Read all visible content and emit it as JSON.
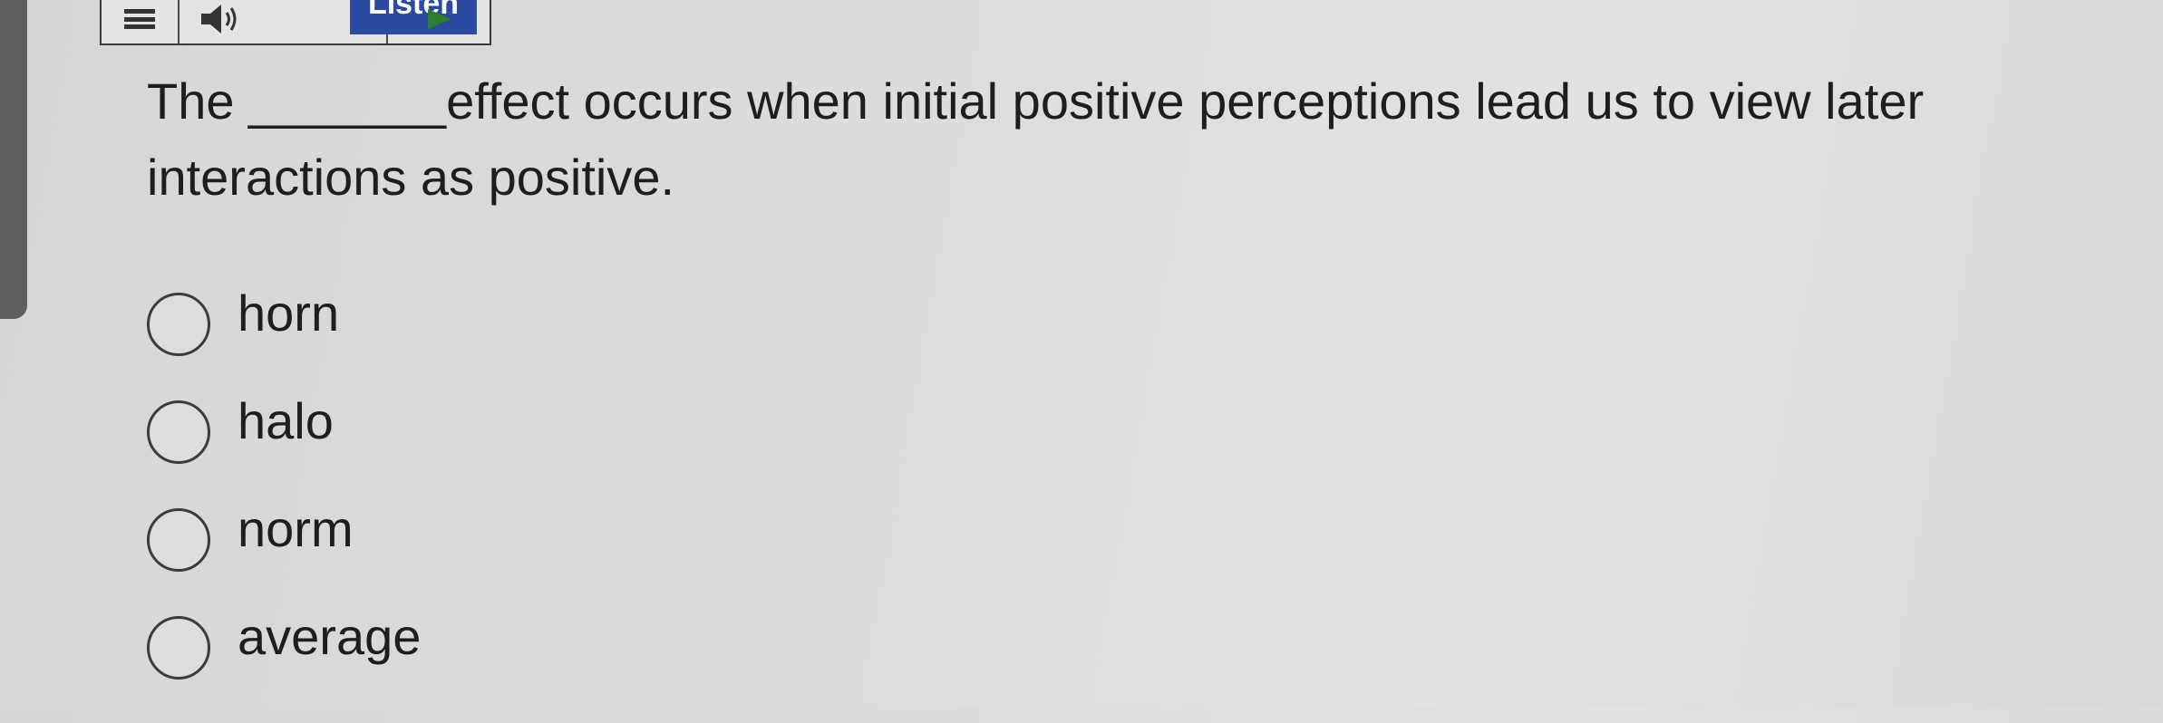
{
  "toolbar": {
    "menu_icon": "hamburger-icon",
    "speaker_icon": "speaker-icon",
    "listen_label": "Listen",
    "play_icon": "play-icon"
  },
  "question": {
    "text": "The _______effect occurs when initial positive perceptions lead us to view later interactions as positive."
  },
  "options": [
    {
      "label": "horn",
      "selected": false
    },
    {
      "label": "halo",
      "selected": false
    },
    {
      "label": "norm",
      "selected": false
    },
    {
      "label": "average",
      "selected": false
    }
  ],
  "colors": {
    "background": "#dcdcdc",
    "text": "#1e1e1e",
    "listen_button": "#2b4aa0",
    "scrollbar": "#5e5e5e"
  }
}
